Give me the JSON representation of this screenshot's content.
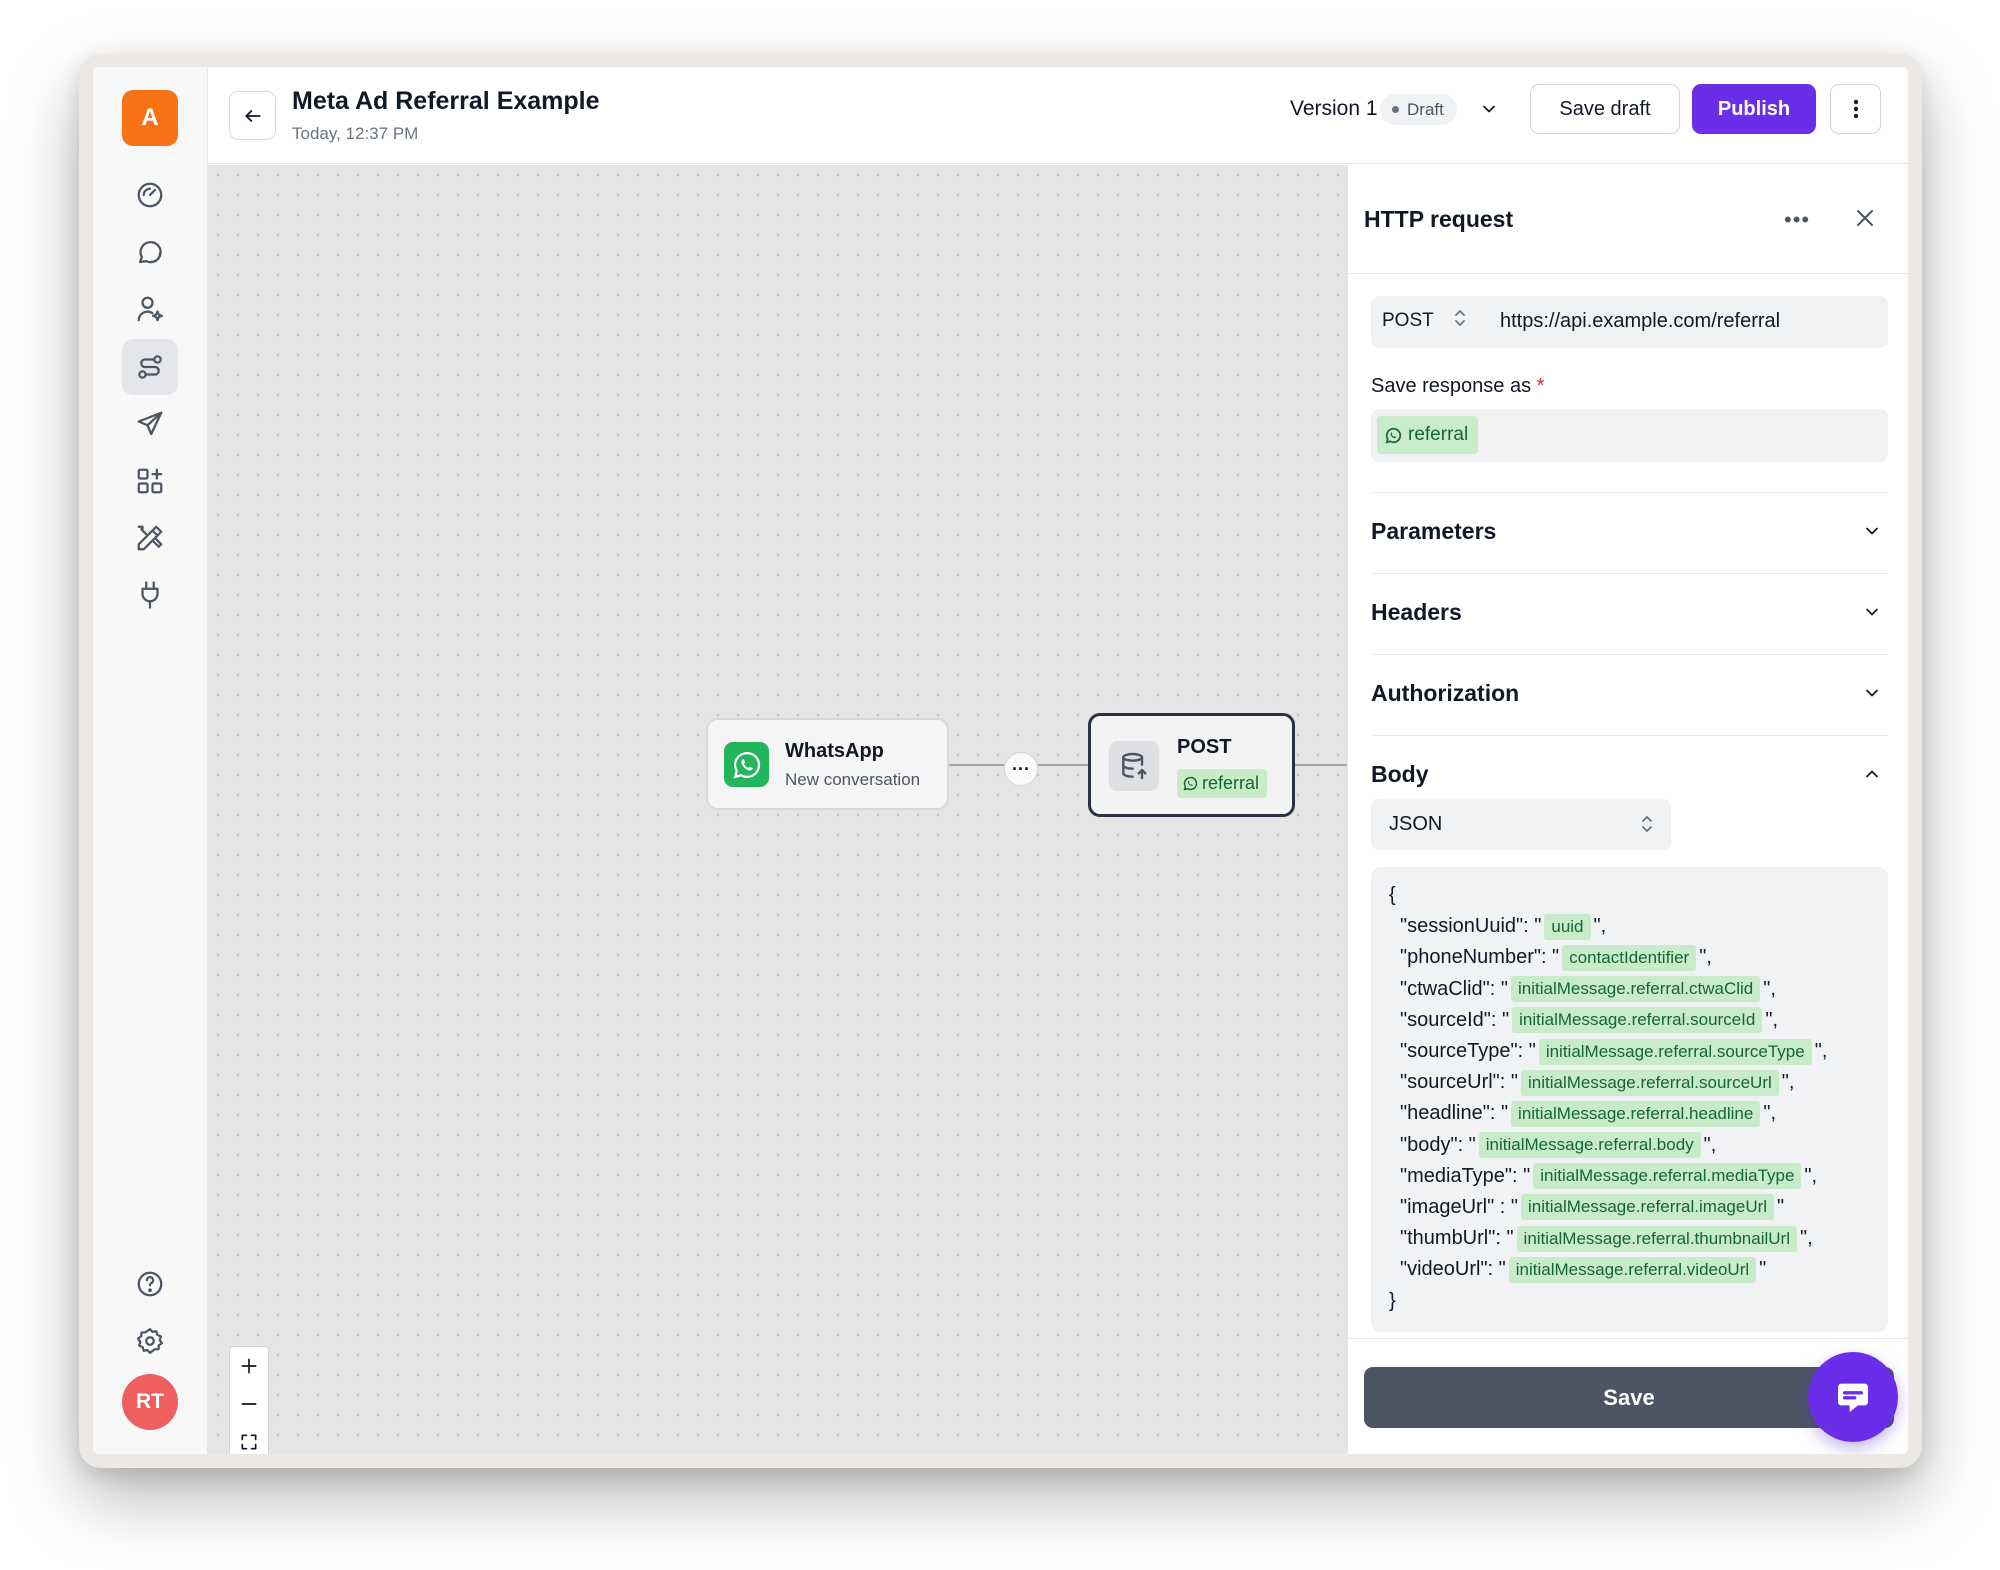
{
  "app": {
    "brand_initial": "A",
    "user_initials": "RT"
  },
  "sidebar": {
    "items": [
      {
        "icon": "dashboard-gauge-icon"
      },
      {
        "icon": "chat-bubble-icon"
      },
      {
        "icon": "contacts-user-icon"
      },
      {
        "icon": "flows-route-icon",
        "active": true
      },
      {
        "icon": "send-paper-plane-icon"
      },
      {
        "icon": "apps-grid-icon"
      },
      {
        "icon": "tools-pencil-ruler-icon"
      },
      {
        "icon": "integrations-plug-icon"
      }
    ],
    "bottom_items": [
      {
        "icon": "help-circle-icon"
      },
      {
        "icon": "settings-gear-icon"
      }
    ]
  },
  "header": {
    "title": "Meta Ad Referral Example",
    "subtitle": "Today, 12:37 PM",
    "version_label": "Version 1",
    "status": "Draft",
    "save_draft_label": "Save draft",
    "publish_label": "Publish"
  },
  "canvas": {
    "nodes": [
      {
        "title": "WhatsApp",
        "subtitle": "New conversation",
        "icon": "whatsapp-icon"
      },
      {
        "title": "POST",
        "tag": "referral",
        "icon": "database-upload-icon"
      }
    ],
    "edge_handle": "···",
    "zoom_controls": [
      "zoom-in-icon",
      "zoom-out-icon",
      "fit-view-icon",
      "center-icon"
    ]
  },
  "panel": {
    "title": "HTTP request",
    "method": "POST",
    "url": "https://api.example.com/referral",
    "save_response_label": "Save response as",
    "required_mark": "*",
    "response_variable": "referral",
    "sections": [
      {
        "label": "Parameters",
        "expanded": false
      },
      {
        "label": "Headers",
        "expanded": false
      },
      {
        "label": "Authorization",
        "expanded": false
      },
      {
        "label": "Body",
        "expanded": true
      }
    ],
    "body_format": "JSON",
    "body_open": "{",
    "body_close": "}",
    "body_lines": [
      {
        "key": "\"sessionUuid\": \"",
        "var": "uuid",
        "suffix": "\","
      },
      {
        "key": "\"phoneNumber\": \"",
        "var": "contactIdentifier",
        "suffix": "\","
      },
      {
        "key": "\"ctwaClid\": \"",
        "var": "initialMessage.referral.ctwaClid",
        "suffix": "\","
      },
      {
        "key": "\"sourceId\": \"",
        "var": "initialMessage.referral.sourceId",
        "suffix": "\","
      },
      {
        "key": "\"sourceType\": \"",
        "var": "initialMessage.referral.sourceType",
        "suffix": "\","
      },
      {
        "key": "\"sourceUrl\": \"",
        "var": "initialMessage.referral.sourceUrl",
        "suffix": "\","
      },
      {
        "key": "\"headline\": \"",
        "var": "initialMessage.referral.headline",
        "suffix": "\","
      },
      {
        "key": "\"body\": \"",
        "var": "initialMessage.referral.body",
        "suffix": "\","
      },
      {
        "key": "\"mediaType\": \"",
        "var": "initialMessage.referral.mediaType",
        "suffix": "\","
      },
      {
        "key": "\"imageUrl\" : \"",
        "var": "initialMessage.referral.imageUrl",
        "suffix": "\""
      },
      {
        "key": "\"thumbUrl\": \"",
        "var": "initialMessage.referral.thumbnailUrl",
        "suffix": "\","
      },
      {
        "key": "\"videoUrl\": \"",
        "var": "initialMessage.referral.videoUrl",
        "suffix": "\""
      }
    ],
    "save_label": "Save"
  },
  "colors": {
    "brand": "#f97316",
    "primary": "#6b2ee8",
    "variable_chip_bg": "#c8ecca",
    "variable_chip_text": "#166534",
    "whatsapp": "#22b55b",
    "save_button": "#4b5563",
    "avatar": "#ef5f5f"
  }
}
